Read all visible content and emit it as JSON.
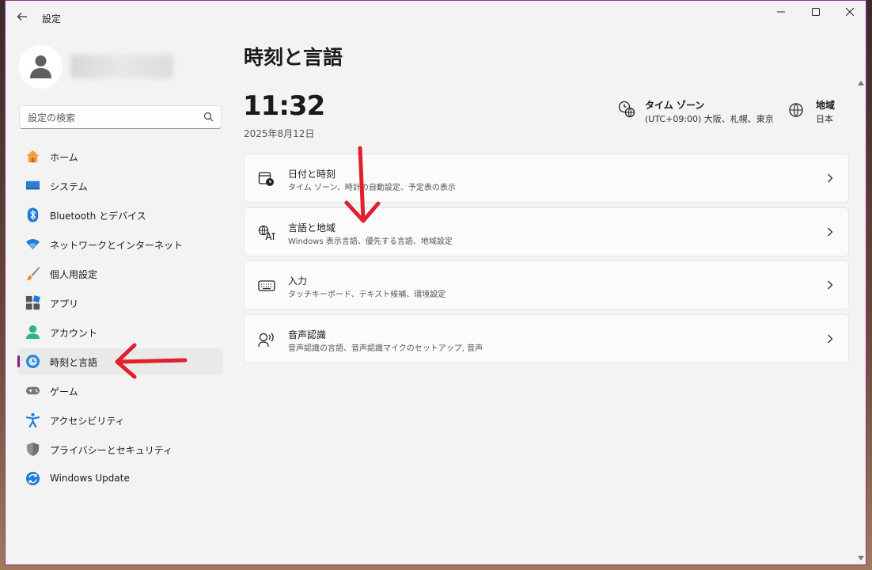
{
  "window": {
    "title": "設定",
    "controls": {
      "minimize": "—",
      "maximize": "☐",
      "close": "✕"
    }
  },
  "search": {
    "placeholder": "設定の検索"
  },
  "sidebar": {
    "items": [
      {
        "label": "ホーム",
        "icon": "home-icon"
      },
      {
        "label": "システム",
        "icon": "system-icon"
      },
      {
        "label": "Bluetooth とデバイス",
        "icon": "bluetooth-icon"
      },
      {
        "label": "ネットワークとインターネット",
        "icon": "wifi-icon"
      },
      {
        "label": "個人用設定",
        "icon": "brush-icon"
      },
      {
        "label": "アプリ",
        "icon": "apps-icon"
      },
      {
        "label": "アカウント",
        "icon": "account-icon"
      },
      {
        "label": "時刻と言語",
        "icon": "time-language-icon",
        "selected": true
      },
      {
        "label": "ゲーム",
        "icon": "gamepad-icon"
      },
      {
        "label": "アクセシビリティ",
        "icon": "accessibility-icon"
      },
      {
        "label": "プライバシーとセキュリティ",
        "icon": "shield-icon"
      },
      {
        "label": "Windows Update",
        "icon": "update-icon"
      }
    ]
  },
  "main": {
    "title": "時刻と言語",
    "time": "11:32",
    "date": "2025年8月12日",
    "timezone": {
      "title": "タイム ゾーン",
      "value": "(UTC+09:00) 大阪、札幌、東京"
    },
    "region": {
      "title": "地域",
      "value": "日本"
    },
    "cards": [
      {
        "title": "日付と時刻",
        "subtitle": "タイム ゾーン、時計の自動設定、予定表の表示",
        "icon": "calendar-clock-icon"
      },
      {
        "title": "言語と地域",
        "subtitle": "Windows 表示言語、優先する言語、地域設定",
        "icon": "language-icon"
      },
      {
        "title": "入力",
        "subtitle": "タッチキーボード、テキスト候補、環境設定",
        "icon": "keyboard-icon"
      },
      {
        "title": "音声認識",
        "subtitle": "音声認識の言語、音声認識マイクのセットアップ, 音声",
        "icon": "speech-icon"
      }
    ]
  },
  "colors": {
    "accent": "#8a1a8a",
    "annotation": "#e0202c",
    "window_border": "#9c2d8f"
  }
}
